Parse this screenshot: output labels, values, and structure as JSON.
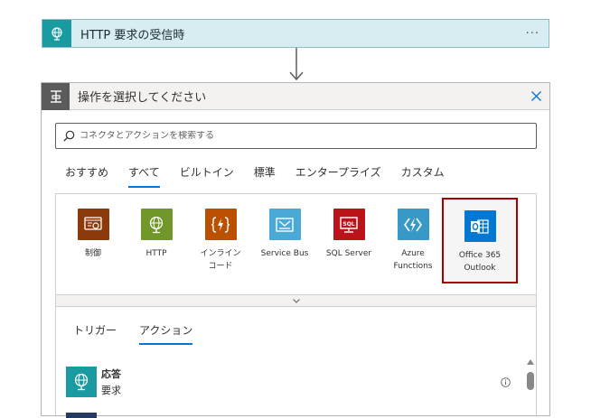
{
  "trigger": {
    "title": "HTTP 要求の受信時",
    "more_label": "···",
    "icon": "globe-icon",
    "color": "#1a9ba1"
  },
  "panel": {
    "title": "操作を選択してください",
    "header_icon": "action-icon",
    "close_icon": "close-icon"
  },
  "search": {
    "placeholder": "コネクタとアクションを検索する",
    "value": ""
  },
  "category_tabs": [
    {
      "label": "おすすめ",
      "active": false
    },
    {
      "label": "すべて",
      "active": true
    },
    {
      "label": "ビルトイン",
      "active": false
    },
    {
      "label": "標準",
      "active": false
    },
    {
      "label": "エンタープライズ",
      "active": false
    },
    {
      "label": "カスタム",
      "active": false
    }
  ],
  "connectors": [
    {
      "label": "制御",
      "icon": "control-icon",
      "color": "#8c3a0c"
    },
    {
      "label": "HTTP",
      "icon": "globe-icon",
      "color": "#709727"
    },
    {
      "label": "インライン\nコード",
      "icon": "inline-code-icon",
      "color": "#ba5000"
    },
    {
      "label": "Service Bus",
      "icon": "service-bus-icon",
      "color": "#4ba9d6"
    },
    {
      "label": "SQL Server",
      "icon": "sql-server-icon",
      "color": "#ba141a"
    },
    {
      "label": "Azure\nFunctions",
      "icon": "azure-functions-icon",
      "color": "#3999c6"
    },
    {
      "label": "Office 365\nOutlook",
      "icon": "outlook-icon",
      "color": "#0078d4",
      "selected": true
    }
  ],
  "sub_tabs": [
    {
      "label": "トリガー",
      "active": false
    },
    {
      "label": "アクション",
      "active": true
    }
  ],
  "actions": [
    {
      "name": "応答",
      "description": "要求",
      "icon": "globe-icon"
    }
  ],
  "colors": {
    "accent": "#0078d4",
    "selection_border": "#a80000",
    "trigger_bg": "#d8edf1"
  }
}
